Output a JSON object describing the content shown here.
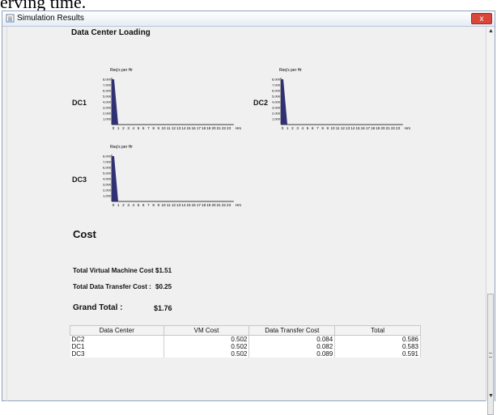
{
  "top_text": "erving time.",
  "window": {
    "title": "Simulation Results",
    "close_label": "x"
  },
  "loading": {
    "heading": "Data Center Loading",
    "charts": [
      {
        "dc": "DC1",
        "ylabel": "Req's per Hr",
        "xunit": "Hrs"
      },
      {
        "dc": "DC2",
        "ylabel": "Req's per Hr",
        "xunit": "Hrs"
      },
      {
        "dc": "DC3",
        "ylabel": "Req's per Hr",
        "xunit": "Hrs"
      }
    ]
  },
  "chart_data": [
    {
      "type": "bar",
      "title": "DC1",
      "ylabel": "Req's per Hr",
      "xlabel": "Hrs",
      "x": [
        0,
        1,
        2,
        3,
        4,
        5,
        6,
        7,
        8,
        9,
        10,
        11,
        12,
        13,
        14,
        15,
        16,
        17,
        18,
        19,
        20,
        21,
        22,
        23
      ],
      "values": [
        8000,
        0,
        0,
        0,
        0,
        0,
        0,
        0,
        0,
        0,
        0,
        0,
        0,
        0,
        0,
        0,
        0,
        0,
        0,
        0,
        0,
        0,
        0,
        0
      ],
      "yticks": [
        1000,
        2000,
        3000,
        4000,
        5000,
        6000,
        7000,
        8000
      ],
      "ylim": [
        0,
        8000
      ]
    },
    {
      "type": "bar",
      "title": "DC2",
      "ylabel": "Req's per Hr",
      "xlabel": "Hrs",
      "x": [
        0,
        1,
        2,
        3,
        4,
        5,
        6,
        7,
        8,
        9,
        10,
        11,
        12,
        13,
        14,
        15,
        16,
        17,
        18,
        19,
        20,
        21,
        22,
        23
      ],
      "values": [
        8000,
        0,
        0,
        0,
        0,
        0,
        0,
        0,
        0,
        0,
        0,
        0,
        0,
        0,
        0,
        0,
        0,
        0,
        0,
        0,
        0,
        0,
        0,
        0
      ],
      "yticks": [
        1000,
        2000,
        3000,
        4000,
        5000,
        6000,
        7000,
        8000
      ],
      "ylim": [
        0,
        8000
      ]
    },
    {
      "type": "bar",
      "title": "DC3",
      "ylabel": "Req's per Hr",
      "xlabel": "Hrs",
      "x": [
        0,
        1,
        2,
        3,
        4,
        5,
        6,
        7,
        8,
        9,
        10,
        11,
        12,
        13,
        14,
        15,
        16,
        17,
        18,
        19,
        20,
        21,
        22,
        23
      ],
      "values": [
        8000,
        0,
        0,
        0,
        0,
        0,
        0,
        0,
        0,
        0,
        0,
        0,
        0,
        0,
        0,
        0,
        0,
        0,
        0,
        0,
        0,
        0,
        0,
        0
      ],
      "yticks": [
        1000,
        2000,
        3000,
        4000,
        5000,
        6000,
        7000,
        8000
      ],
      "ylim": [
        0,
        8000
      ]
    }
  ],
  "cost": {
    "heading": "Cost",
    "vm_label": "Total Virtual Machine Cost :",
    "vm_value": "$1.51",
    "dt_label": "Total Data Transfer Cost :",
    "dt_value": "$0.25",
    "grand_label": "Grand Total :",
    "grand_value": "$1.76"
  },
  "table": {
    "headers": [
      "Data Center",
      "VM Cost",
      "Data Transfer Cost",
      "Total"
    ],
    "rows": [
      [
        "DC2",
        "0.502",
        "0.084",
        "0.586"
      ],
      [
        "DC1",
        "0.502",
        "0.082",
        "0.583"
      ],
      [
        "DC3",
        "0.502",
        "0.089",
        "0.591"
      ]
    ]
  },
  "colors": {
    "bar": "#2f3173",
    "accent": "#d9463a"
  }
}
